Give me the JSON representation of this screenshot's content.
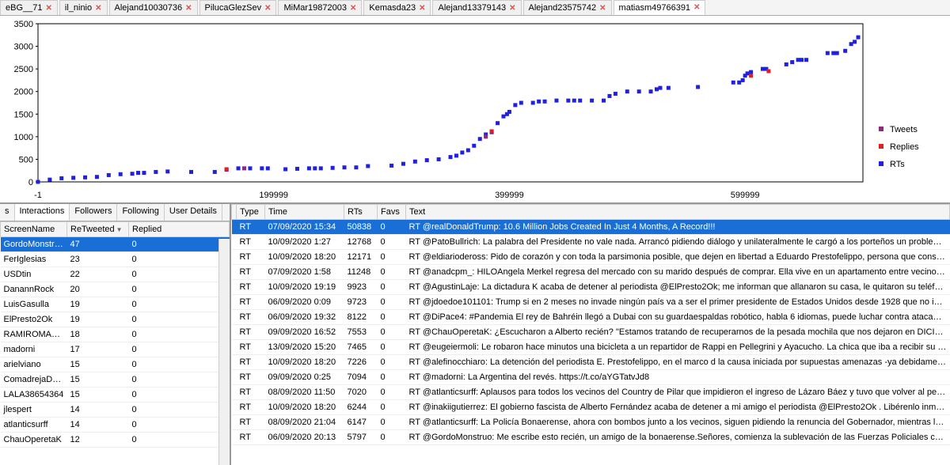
{
  "tabs": [
    {
      "label": "eBG__71",
      "active": false
    },
    {
      "label": "il_ninio",
      "active": false
    },
    {
      "label": "Alejand10030736",
      "active": false
    },
    {
      "label": "PilucaGlezSev",
      "active": false
    },
    {
      "label": "MiMar19872003",
      "active": false
    },
    {
      "label": "Kemasda23",
      "active": false
    },
    {
      "label": "Alejand13379143",
      "active": false
    },
    {
      "label": "Alejand23575742",
      "active": false
    },
    {
      "label": "matiasm49766391",
      "active": true
    }
  ],
  "chart_data": {
    "type": "scatter",
    "xlabel": "",
    "ylabel": "",
    "xlim": [
      -1,
      700000
    ],
    "ylim": [
      0,
      3500
    ],
    "xticks": [
      "-1",
      "199999",
      "399999",
      "599999"
    ],
    "yticks": [
      "0",
      "500",
      "1000",
      "1500",
      "2000",
      "2500",
      "3000",
      "3500"
    ],
    "legend": [
      "Tweets",
      "Replies",
      "RTs"
    ],
    "legend_colors": [
      "#8c2b7a",
      "#e02020",
      "#2020e0"
    ],
    "series": [
      {
        "name": "RTs",
        "color": "#2020e0",
        "points": [
          [
            0,
            0
          ],
          [
            10000,
            50
          ],
          [
            20000,
            80
          ],
          [
            30000,
            90
          ],
          [
            40000,
            100
          ],
          [
            50000,
            110
          ],
          [
            60000,
            150
          ],
          [
            70000,
            170
          ],
          [
            80000,
            180
          ],
          [
            85000,
            200
          ],
          [
            90000,
            200
          ],
          [
            100000,
            220
          ],
          [
            110000,
            230
          ],
          [
            130000,
            220
          ],
          [
            150000,
            220
          ],
          [
            160000,
            270
          ],
          [
            170000,
            300
          ],
          [
            180000,
            300
          ],
          [
            190000,
            300
          ],
          [
            195000,
            300
          ],
          [
            210000,
            280
          ],
          [
            220000,
            290
          ],
          [
            230000,
            300
          ],
          [
            235000,
            300
          ],
          [
            240000,
            300
          ],
          [
            250000,
            310
          ],
          [
            260000,
            320
          ],
          [
            270000,
            320
          ],
          [
            280000,
            350
          ],
          [
            300000,
            360
          ],
          [
            310000,
            400
          ],
          [
            320000,
            450
          ],
          [
            330000,
            480
          ],
          [
            340000,
            500
          ],
          [
            350000,
            550
          ],
          [
            355000,
            580
          ],
          [
            360000,
            650
          ],
          [
            365000,
            700
          ],
          [
            370000,
            800
          ],
          [
            375000,
            950
          ],
          [
            380000,
            1050
          ],
          [
            385000,
            1100
          ],
          [
            390000,
            1300
          ],
          [
            395000,
            1450
          ],
          [
            398000,
            1500
          ],
          [
            400000,
            1550
          ],
          [
            405000,
            1700
          ],
          [
            410000,
            1750
          ],
          [
            420000,
            1750
          ],
          [
            425000,
            1780
          ],
          [
            430000,
            1780
          ],
          [
            440000,
            1800
          ],
          [
            450000,
            1800
          ],
          [
            455000,
            1800
          ],
          [
            460000,
            1800
          ],
          [
            470000,
            1800
          ],
          [
            480000,
            1800
          ],
          [
            485000,
            1900
          ],
          [
            490000,
            1950
          ],
          [
            500000,
            2000
          ],
          [
            510000,
            2000
          ],
          [
            520000,
            2000
          ],
          [
            525000,
            2050
          ],
          [
            528000,
            2080
          ],
          [
            535000,
            2080
          ],
          [
            560000,
            2100
          ],
          [
            590000,
            2200
          ],
          [
            595000,
            2200
          ],
          [
            598000,
            2250
          ],
          [
            600000,
            2350
          ],
          [
            602000,
            2400
          ],
          [
            605000,
            2430
          ],
          [
            615000,
            2500
          ],
          [
            618000,
            2500
          ],
          [
            635000,
            2600
          ],
          [
            640000,
            2650
          ],
          [
            645000,
            2700
          ],
          [
            648000,
            2700
          ],
          [
            652000,
            2700
          ],
          [
            670000,
            2850
          ],
          [
            675000,
            2850
          ],
          [
            678000,
            2850
          ],
          [
            685000,
            2900
          ],
          [
            690000,
            3050
          ],
          [
            693000,
            3100
          ],
          [
            696000,
            3200
          ]
        ]
      },
      {
        "name": "Replies",
        "color": "#e02020",
        "points": [
          [
            160000,
            280
          ],
          [
            385000,
            1120
          ],
          [
            605000,
            2350
          ],
          [
            620000,
            2450
          ]
        ]
      },
      {
        "name": "Tweets",
        "color": "#8c2b7a",
        "points": [
          [
            175000,
            300
          ],
          [
            380000,
            1000
          ]
        ]
      }
    ]
  },
  "inner_tabs": [
    "s",
    "Interactions",
    "Followers",
    "Following",
    "User Details"
  ],
  "inner_active": 1,
  "interactions": {
    "headers": [
      "ScreenName",
      "ReTweeted",
      "Replied"
    ],
    "rows": [
      {
        "name": "GordoMonstruo",
        "rt": "47",
        "rp": "0",
        "sel": true
      },
      {
        "name": "FerIglesias",
        "rt": "23",
        "rp": "0"
      },
      {
        "name": "USDtin",
        "rt": "22",
        "rp": "0"
      },
      {
        "name": "DanannRock",
        "rt": "20",
        "rp": "0"
      },
      {
        "name": "LuisGasulla",
        "rt": "19",
        "rp": "0"
      },
      {
        "name": "ElPresto2Ok",
        "rt": "19",
        "rp": "0"
      },
      {
        "name": "RAMIROMAR...",
        "rt": "18",
        "rp": "0"
      },
      {
        "name": "madorni",
        "rt": "17",
        "rp": "0"
      },
      {
        "name": "arielviano",
        "rt": "15",
        "rp": "0"
      },
      {
        "name": "ComadrejaDark",
        "rt": "15",
        "rp": "0"
      },
      {
        "name": "LALA38654364",
        "rt": "15",
        "rp": "0"
      },
      {
        "name": "jlespert",
        "rt": "14",
        "rp": "0"
      },
      {
        "name": "atlanticsurff",
        "rt": "14",
        "rp": "0"
      },
      {
        "name": "ChauOperetaK",
        "rt": "12",
        "rp": "0"
      }
    ]
  },
  "tweets": {
    "headers": [
      "",
      "Type",
      "Time",
      "RTs",
      "Favs",
      "Text"
    ],
    "rows": [
      {
        "type": "RT",
        "time": "07/09/2020 15:34",
        "rts": "50838",
        "favs": "0",
        "text": "RT @realDonaldTrump: 10.6 Million Jobs Created In Just 4 Months, A Record!!!",
        "sel": true
      },
      {
        "type": "RT",
        "time": "10/09/2020 1:27",
        "rts": "12768",
        "favs": "0",
        "text": "RT @PatoBullrich: La palabra del Presidente no vale nada. Arrancó pidiendo diálogo y unilateralmente le cargó a los porteños un problema qu..."
      },
      {
        "type": "RT",
        "time": "10/09/2020 18:20",
        "rts": "12171",
        "favs": "0",
        "text": "RT @eldiariodeross: Pido de corazón y con toda la parsimonia posible, que dejen en libertad a Eduardo Prestofelippo, persona que considero..."
      },
      {
        "type": "RT",
        "time": "07/09/2020 1:58",
        "rts": "11248",
        "favs": "0",
        "text": "RT @anadcpm_: HILOAngela Merkel regresa del mercado con su marido después de comprar. Ella vive en un apartamento entre vecinos normales..."
      },
      {
        "type": "RT",
        "time": "10/09/2020 19:19",
        "rts": "9923",
        "favs": "0",
        "text": "RT @AgustinLaje: La dictadura K acaba de detener al periodista @ElPresto2Ok; me informan que allanaron su casa, le quitaron su teléfono y s..."
      },
      {
        "type": "RT",
        "time": "06/09/2020 0:09",
        "rts": "9723",
        "favs": "0",
        "text": "RT @jdoedoe101101: Trump si en 2 meses no invade ningún país va a ser el primer presidente de Estados Unidos desde 1928 que no inicia una n..."
      },
      {
        "type": "RT",
        "time": "06/09/2020 19:32",
        "rts": "8122",
        "favs": "0",
        "text": "RT @DiPace4: #Pandemia El rey de Bahréin llegó a Dubai con su guardaespaldas robótico, habla 6 idiomas, puede luchar contra atacantes, tien..."
      },
      {
        "type": "RT",
        "time": "09/09/2020 16:52",
        "rts": "7553",
        "favs": "0",
        "text": "RT @ChauOperetaK: ¿Escucharon a Alberto recién? \"Estamos tratando de recuperarnos de la pesada mochila que nos dejaron en DICIEMBRE DE ..."
      },
      {
        "type": "RT",
        "time": "13/09/2020 15:20",
        "rts": "7465",
        "favs": "0",
        "text": "RT @eugeiermoli: Le robaron hace minutos una bicicleta a un repartidor de Rappi en Pellegrini y Ayacucho. La chica que iba a recibir su ped..."
      },
      {
        "type": "RT",
        "time": "10/09/2020 18:20",
        "rts": "7226",
        "favs": "0",
        "text": "RT @alefinocchiaro: La detención del periodista E. Prestofelippo, en el marco d la causa iniciada por supuestas amenazas -ya debidamente ac..."
      },
      {
        "type": "RT",
        "time": "09/09/2020 0:25",
        "rts": "7094",
        "favs": "0",
        "text": "RT @madorni: La Argentina del revés. https://t.co/aYGTatvJd8"
      },
      {
        "type": "RT",
        "time": "08/09/2020 11:50",
        "rts": "7020",
        "favs": "0",
        "text": "RT @atlanticsurff: Aplausos para todos los vecinos del Country de Pilar que impidieron el ingreso de Lázaro Báez y tuvo que volver al penal..."
      },
      {
        "type": "RT",
        "time": "10/09/2020 18:20",
        "rts": "6244",
        "favs": "0",
        "text": "RT @inakiigutierrez: El gobierno fascista de Alberto Fernández acaba de detener a mi amigo el periodista @ElPresto2Ok . Libérenlo inmediata..."
      },
      {
        "type": "RT",
        "time": "08/09/2020 21:04",
        "rts": "6147",
        "favs": "0",
        "text": "RT @atlanticsurff: La Policía Bonaerense, ahora con bombos junto a los vecinos, siguen pidiendo la renuncia del Gobernador, mientras los me..."
      },
      {
        "type": "RT",
        "time": "06/09/2020 20:13",
        "rts": "5797",
        "favs": "0",
        "text": "RT @GordoMonstruo: Me escribe esto recién, un amigo de la bonaerense.Señores, comienza la sublevación de las Fuerzas Policiales contra la..."
      }
    ]
  }
}
